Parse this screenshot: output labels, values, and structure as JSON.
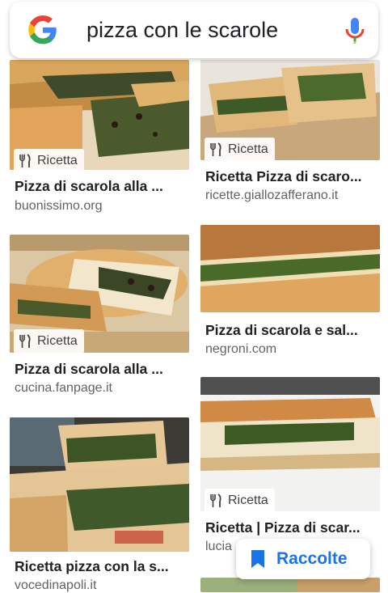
{
  "search": {
    "query": "pizza con le scarole"
  },
  "results": {
    "left": [
      {
        "badge": "Ricetta",
        "title": "Pizza di scarola alla ...",
        "source": "buonissimo.org"
      },
      {
        "badge": "Ricetta",
        "title": "Pizza di scarola alla ...",
        "source": "cucina.fanpage.it"
      },
      {
        "badge": "",
        "title": "Ricetta pizza con la s...",
        "source": "vocedinapoli.it"
      }
    ],
    "right": [
      {
        "badge": "Ricetta",
        "title": "Ricetta Pizza di scaro...",
        "source": "ricette.giallozafferano.it"
      },
      {
        "badge": "",
        "title": "Pizza di scarola e sal...",
        "source": "negroni.com"
      },
      {
        "badge": "Ricetta",
        "title": "Ricetta | Pizza di scar...",
        "source": "lucia"
      }
    ]
  },
  "fab": {
    "label": "Raccolte",
    "color": "#1a73e8"
  },
  "icons": {
    "logo": "google-g-logo",
    "mic": "microphone-icon",
    "badge": "fork-knife-icon",
    "fab": "bookmark-icon"
  }
}
